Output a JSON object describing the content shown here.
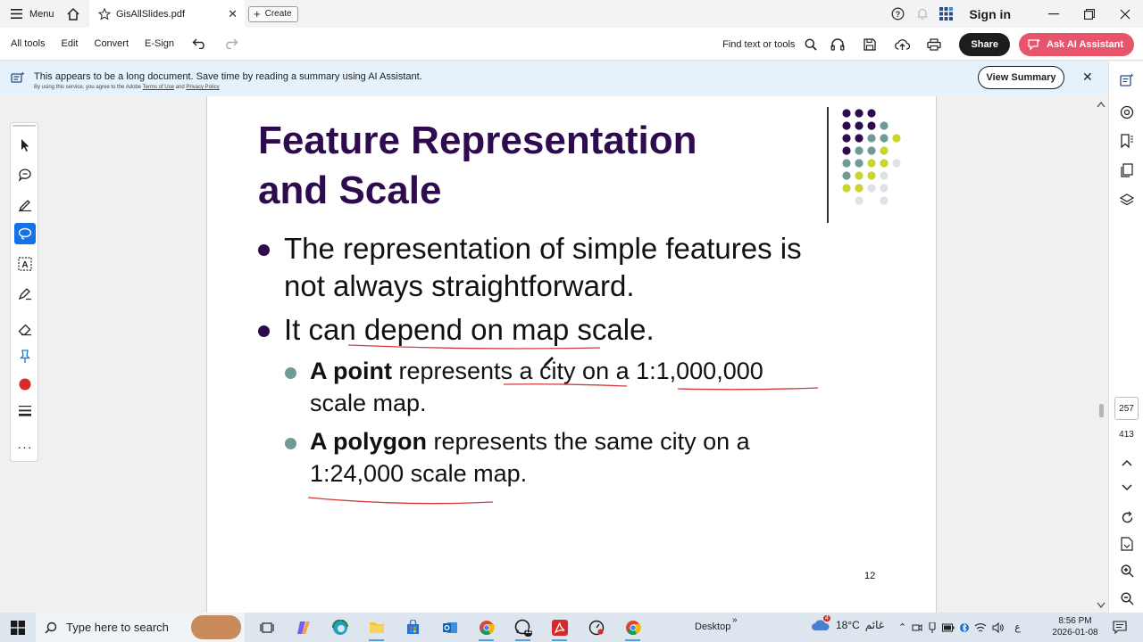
{
  "titlebar": {
    "menu_label": "Menu",
    "tab_title": "GisAllSlides.pdf",
    "create_label": "Create",
    "sign_in": "Sign in"
  },
  "toolbar": {
    "all_tools": "All tools",
    "edit": "Edit",
    "convert": "Convert",
    "esign": "E-Sign",
    "find": "Find text or tools",
    "share": "Share",
    "ask_ai": "Ask AI Assistant"
  },
  "banner": {
    "message": "This appears to be a long document. Save time by reading a summary using AI Assistant.",
    "sub_prefix": "By using this service, you agree to the Adobe",
    "terms": "Terms of Use",
    "and": "and",
    "privacy": "Privacy Policy",
    "view_summary": "View Summary"
  },
  "slide": {
    "title_line1": "Feature Representation",
    "title_line2": "and Scale",
    "bullet1_line1": "The representation of simple features is",
    "bullet1_line2": "not always straightforward.",
    "bullet2": "It can depend on map scale.",
    "sub1_bold": "A point",
    "sub1_rest": " represents a city on a 1:1,000,000",
    "sub1_line2": "scale map.",
    "sub2_bold": "A polygon",
    "sub2_rest": " represents the same city on a",
    "sub2_line2": "1:24,000 scale map.",
    "page_number": "12"
  },
  "navigation": {
    "current_page": "257",
    "total_pages": "413"
  },
  "taskbar": {
    "search_placeholder": "Type here to search",
    "whatsapp_badge": "11",
    "desktop_label": "Desktop",
    "weather_temp": "18°C",
    "weather_text": "غائم",
    "weather_badge": "4",
    "lang": "ع",
    "time": "8:56 PM",
    "date": "2026-01-08"
  },
  "colors": {
    "title_purple": "#2e0b4f",
    "sub_bullet_teal": "#6f9a96",
    "ink_red": "#d23a3a",
    "ai_button": "#e8546b",
    "active_tool": "#1473e6",
    "banner_bg": "#e6f2fb"
  }
}
